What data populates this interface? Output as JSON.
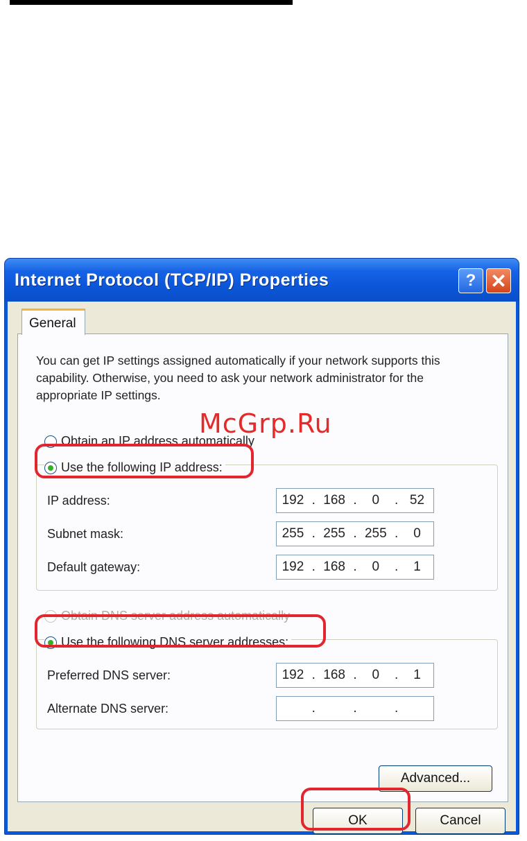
{
  "window": {
    "title": "Internet Protocol (TCP/IP) Properties",
    "help_glyph": "?",
    "close_glyph": "✕"
  },
  "tabs": [
    {
      "label": "General"
    }
  ],
  "intro_text": "You can get IP settings assigned automatically if your network supports this capability. Otherwise, you need to ask your network administrator for the appropriate IP settings.",
  "ip_mode": {
    "auto_label": "Obtain an IP address automatically",
    "manual_label": "Use the following IP address:",
    "selected": "manual"
  },
  "ip_fields": [
    {
      "label": "IP address:",
      "octets": [
        "192",
        "168",
        "0",
        "52"
      ]
    },
    {
      "label": "Subnet mask:",
      "octets": [
        "255",
        "255",
        "255",
        "0"
      ]
    },
    {
      "label": "Default gateway:",
      "octets": [
        "192",
        "168",
        "0",
        "1"
      ]
    }
  ],
  "dns_mode": {
    "auto_label": "Obtain DNS server address automatically",
    "manual_label": "Use the following DNS server addresses:",
    "selected": "manual"
  },
  "dns_fields": [
    {
      "label": "Preferred DNS server:",
      "octets": [
        "192",
        "168",
        "0",
        "1"
      ]
    },
    {
      "label": "Alternate DNS server:",
      "octets": [
        "",
        "",
        "",
        ""
      ]
    }
  ],
  "buttons": {
    "advanced": "Advanced...",
    "ok": "OK",
    "cancel": "Cancel"
  },
  "watermark": "McGrp.Ru",
  "colors": {
    "highlight": "#e1262e",
    "titlebar": "#0a55d6",
    "dialog_bg": "#ece9d8"
  }
}
